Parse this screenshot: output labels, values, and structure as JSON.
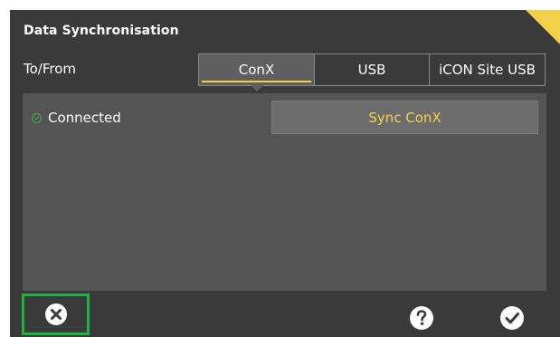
{
  "dialog": {
    "title": "Data Synchronisation"
  },
  "to_from": {
    "label": "To/From",
    "tabs": [
      {
        "label": "ConX",
        "active": true
      },
      {
        "label": "USB",
        "active": false
      },
      {
        "label": "iCON Site USB",
        "active": false
      }
    ]
  },
  "panel": {
    "status_text": "Connected",
    "status_icon": "check-circle-icon",
    "status_color": "#3fae4a",
    "sync_button_label": "Sync ConX",
    "accent_color": "#f2d24a"
  },
  "footer": {
    "close_icon": "close-circle-icon",
    "help_icon": "help-circle-icon",
    "ok_icon": "check-circle-icon",
    "highlight_color": "#1bb43f"
  }
}
